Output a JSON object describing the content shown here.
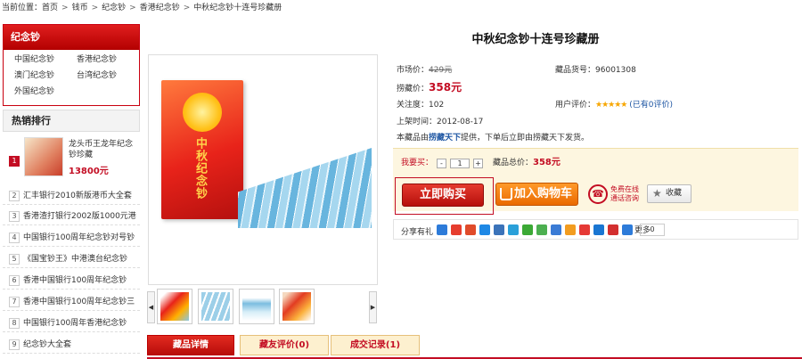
{
  "breadcrumb": {
    "prefix": "当前位置：",
    "items": [
      "首页",
      "钱币",
      "纪念钞",
      "香港纪念钞",
      "中秋纪念钞十连号珍藏册"
    ],
    "sep": ">"
  },
  "category": {
    "title": "纪念钞",
    "items": [
      "中国纪念钞",
      "香港纪念钞",
      "澳门纪念钞",
      "台湾纪念钞",
      "外国纪念钞"
    ]
  },
  "hot": {
    "title": "热销排行",
    "top": {
      "num": "1",
      "title": "龙头币王龙年纪念钞珍藏",
      "price": "13800元"
    },
    "items": [
      {
        "num": "2",
        "title": "汇丰银行2010新版港币大全套"
      },
      {
        "num": "3",
        "title": "香港渣打银行2002版1000元港"
      },
      {
        "num": "4",
        "title": "中国银行100周年纪念钞对号钞"
      },
      {
        "num": "5",
        "title": "《国宝钞王》中港澳台纪念钞"
      },
      {
        "num": "6",
        "title": "香港中国银行100周年纪念钞"
      },
      {
        "num": "7",
        "title": "香港中国银行100周年纪念钞三"
      },
      {
        "num": "8",
        "title": "中国银行100周年香港纪念钞"
      },
      {
        "num": "9",
        "title": "纪念钞大全套"
      }
    ]
  },
  "gallery": {
    "book_text": "中秋纪念钞",
    "prev": "◀",
    "next": "▶"
  },
  "product": {
    "title": "中秋纪念钞十连号珍藏册",
    "market_label": "市场价：",
    "market_price": "429元",
    "id_label": "藏品货号：",
    "id": "96001308",
    "price_label": "捞藏价：",
    "price": "358元",
    "attention_label": "关注度：",
    "attention": "102",
    "rating_label": "用户评价：",
    "rating_count": "(已有0评价)",
    "date_label": "上架时间：",
    "date": "2012-08-17",
    "provider_pre": "本藏品由",
    "provider": "捞藏天下",
    "provider_post": "提供，下单后立即由捞藏天下发货。"
  },
  "buy": {
    "qty_label": "我要买：",
    "minus": "-",
    "qty": "1",
    "plus": "+",
    "total_label": "藏品总价：",
    "total": "358元",
    "buy_now": "立即购买",
    "add_cart": "加入购物车",
    "phone_line1": "免费在线",
    "phone_line2": "通话咨询",
    "favorite": "收藏"
  },
  "share": {
    "label": "分享有礼",
    "more": "更多",
    "count": "0"
  },
  "tabs": [
    "藏品详情",
    "藏友评价(0)",
    "成交记录(1)"
  ],
  "colors": {
    "accent": "#c30d23",
    "orange": "#ea6a00",
    "link": "#1e56a3"
  }
}
